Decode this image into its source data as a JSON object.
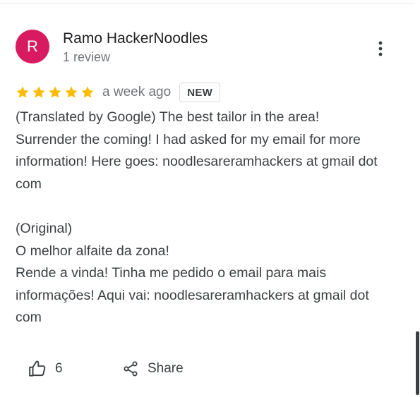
{
  "review": {
    "avatar_letter": "R",
    "avatar_color": "#d81b60",
    "reviewer_name": "Ramo HackerNoodles",
    "review_count": "1 review",
    "rating": 5,
    "rating_max": 5,
    "date": "a week ago",
    "badge": "NEW",
    "text": "(Translated by Google) The best tailor in the area!\nSurrender the coming! I had asked for my email for more information! Here goes: noodlesareramhackers at gmail dot com\n\n(Original)\nO melhor alfaite da zona!\nRende a vinda! Tinha me pedido o email para mais informações! Aqui vai: noodlesareramhackers at gmail dot com"
  },
  "actions": {
    "like_count": "6",
    "share_label": "Share"
  },
  "icons": {
    "more": "more-vertical-icon",
    "star": "star-icon",
    "like": "thumbs-up-icon",
    "share": "share-icon"
  },
  "colors": {
    "star": "#fbbc04",
    "text": "#3c4043",
    "secondary_text": "#70757a"
  }
}
